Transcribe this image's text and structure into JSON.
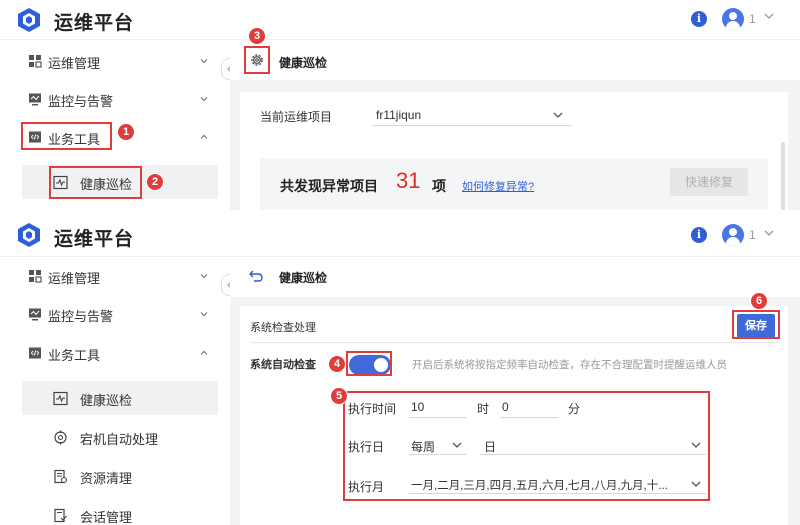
{
  "app": {
    "title": "运维平台",
    "user_label": "1"
  },
  "sidebar": {
    "ops_label": "运维管理",
    "monitor_label": "监控与告警",
    "tools_label": "业务工具",
    "health_label": "健康巡检",
    "host_label": "宕机自动处理",
    "cleanup_label": "资源清理",
    "session_label": "会话管理"
  },
  "top_screen": {
    "breadcrumb": "健康巡检",
    "project_label": "当前运维项目",
    "project_value": "fr11jiqun",
    "found_prefix": "共发现异常项目",
    "found_count": "31",
    "found_suffix": "项",
    "fix_link": "如何修复异常?",
    "quick_fix": "快速修复"
  },
  "bottom_screen": {
    "breadcrumb": "健康巡检",
    "section_title": "系统检查处理",
    "save": "保存",
    "auto_check_label": "系统自动检查",
    "auto_check_on": true,
    "auto_check_hint": "开启后系统将按指定频率自动检查，存在不合理配置时提醒运维人员",
    "exec_time_label": "执行时间",
    "hour_value": "10",
    "hour_unit": "时",
    "minute_value": "0",
    "minute_unit": "分",
    "exec_day_label": "执行日",
    "day_freq": "每周",
    "day_value": "日",
    "exec_month_label": "执行月",
    "month_value": "一月,二月,三月,四月,五月,六月,七月,八月,九月,十..."
  },
  "annotations": {
    "n1": "1",
    "n2": "2",
    "n3": "3",
    "n4": "4",
    "n5": "5",
    "n6": "6"
  },
  "colors": {
    "accent": "#3f6ad8",
    "highlight": "#e03c3c",
    "count": "#d93025",
    "link": "#2f5fd6"
  },
  "icons": [
    "logo-cube-icon",
    "info-icon",
    "avatar-icon",
    "chevron-down-icon",
    "grid-icon",
    "monitor-icon",
    "code-icon",
    "pulse-icon",
    "gear-icon",
    "back-arrow-icon",
    "collapse-icon",
    "host-icon",
    "broom-icon",
    "session-icon"
  ]
}
